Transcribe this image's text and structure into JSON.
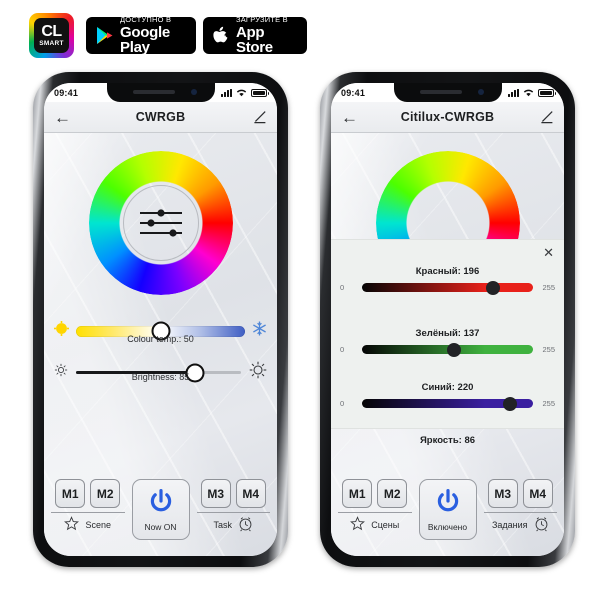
{
  "badges": {
    "logo": {
      "cl": "CL",
      "smart": "SMART"
    },
    "google_play": {
      "small": "ДОСТУПНО В",
      "big": "Google Play",
      "icon": "google-play-icon"
    },
    "app_store": {
      "small": "Загрузите в",
      "big": "App Store",
      "icon": "apple-icon"
    }
  },
  "phone_left": {
    "status": {
      "time": "09:41",
      "signal_icon": "cellular-signal-icon",
      "wifi_icon": "wifi-icon",
      "battery_icon": "battery-icon"
    },
    "appbar": {
      "back_icon": "back-arrow-icon",
      "title": "CWRGB",
      "edit_icon": "pencil-edit-icon"
    },
    "wheel": {
      "name": "colour-wheel",
      "center_icon": "equalizer-sliders-icon"
    },
    "colour_temp": {
      "label": "Colour temp.: 50",
      "value": 50,
      "left_icon": "warm-sun-icon",
      "right_icon": "snowflake-icon",
      "warm_color": "#ffe000",
      "cool_color": "#3f5ec4"
    },
    "brightness": {
      "label": "Brightness: 85",
      "value": 85,
      "left_icon": "small-sun-icon",
      "right_icon": "large-sun-icon"
    },
    "memory": [
      "M1",
      "M2",
      "M3",
      "M4"
    ],
    "power": {
      "icon": "power-icon",
      "label": "Now ON",
      "color": "#2a5fe0"
    },
    "scene": {
      "icon": "star-icon",
      "label": "Scene"
    },
    "task": {
      "icon": "alarm-clock-icon",
      "label": "Task"
    }
  },
  "phone_right": {
    "status": {
      "time": "09:41",
      "signal_icon": "cellular-signal-icon",
      "wifi_icon": "wifi-icon",
      "battery_icon": "battery-icon"
    },
    "appbar": {
      "back_icon": "back-arrow-icon",
      "title": "Citilux-CWRGB",
      "edit_icon": "pencil-edit-icon"
    },
    "rgb_panel": {
      "close_icon": "close-x-icon",
      "min": "0",
      "max": "255",
      "sliders": [
        {
          "name": "red",
          "label": "Красный: 196",
          "value": 196,
          "color": "#e8211a"
        },
        {
          "name": "green",
          "label": "Зелёный: 137",
          "value": 137,
          "color": "#3fb23f"
        },
        {
          "name": "blue",
          "label": "Синий: 220",
          "value": 220,
          "color": "#3a1fa0"
        }
      ]
    },
    "brightness": {
      "label": "Яркость: 86",
      "value": 86
    },
    "memory": [
      "M1",
      "M2",
      "M3",
      "M4"
    ],
    "power": {
      "icon": "power-icon",
      "label": "Включено",
      "color": "#2a5fe0"
    },
    "scene": {
      "icon": "star-icon",
      "label": "Сцены"
    },
    "task": {
      "icon": "alarm-clock-icon",
      "label": "Задания"
    }
  }
}
